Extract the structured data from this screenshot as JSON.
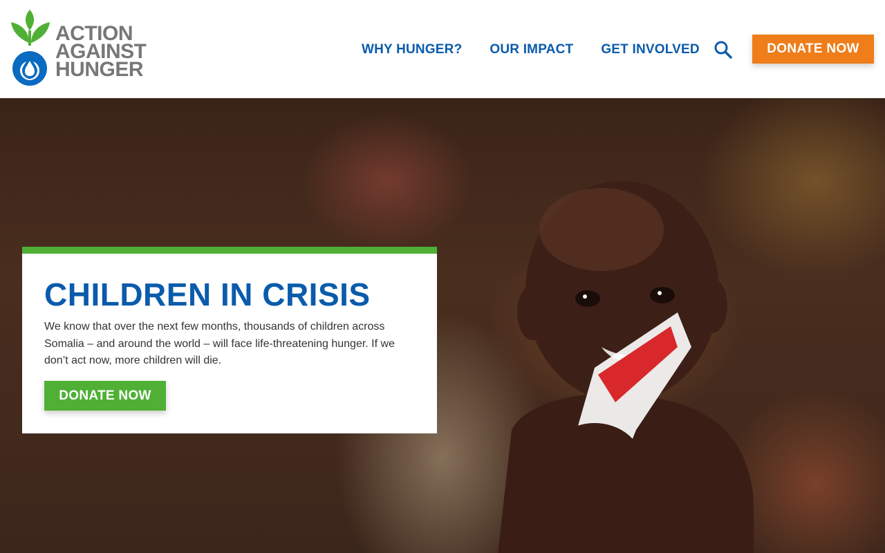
{
  "brand": {
    "logo_lines": [
      "ACTION",
      "AGAINST",
      "HUNGER"
    ],
    "logo_alt": "Action Against Hunger",
    "colors": {
      "green": "#4fb035",
      "blue": "#0a5bab",
      "orange": "#ee7d1a",
      "gray": "#777777"
    }
  },
  "nav": {
    "items": [
      {
        "label": "WHY HUNGER?"
      },
      {
        "label": "OUR IMPACT"
      },
      {
        "label": "GET INVOLVED"
      }
    ],
    "search_icon": "search-icon",
    "donate_label": "DONATE NOW"
  },
  "hero": {
    "title": "CHILDREN IN CRISIS",
    "body": "We know that over the next few months, thousands of children across Somalia – and around the world – will face life-threatening hunger. If we don’t act now, more children will die.",
    "cta_label": "DONATE NOW"
  }
}
